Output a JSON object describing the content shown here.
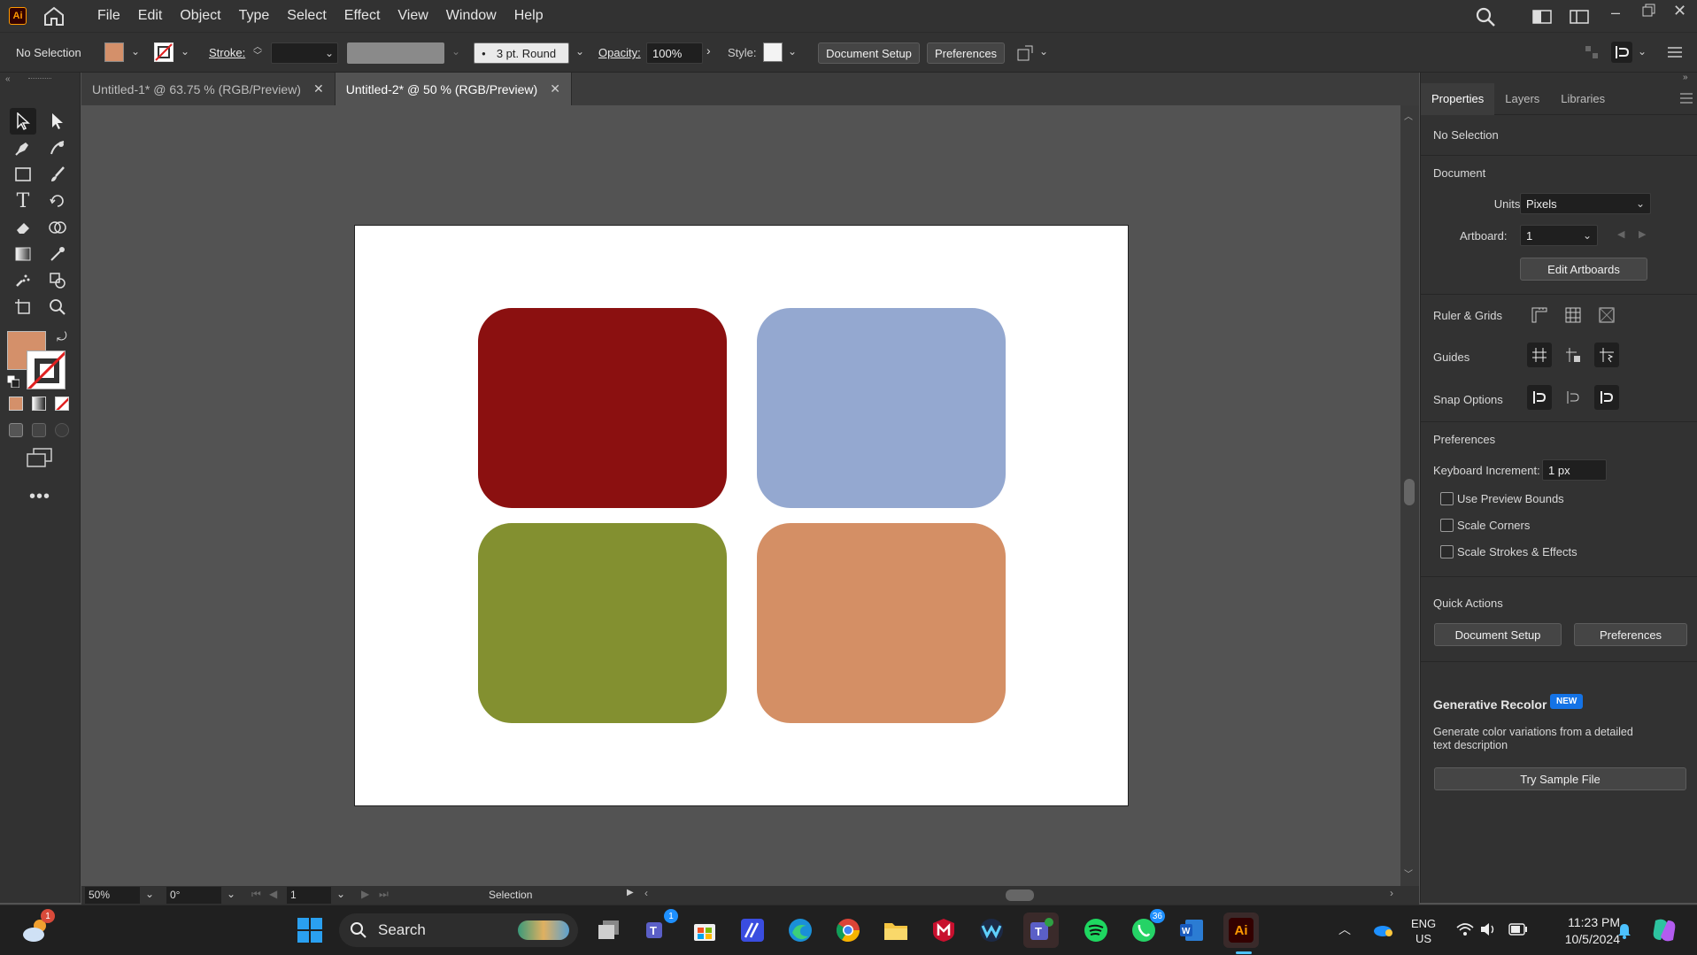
{
  "app": {
    "name": "Ai",
    "brand_color": "#ff9a00",
    "home_icon": "home-icon"
  },
  "menu": [
    "File",
    "Edit",
    "Object",
    "Type",
    "Select",
    "Effect",
    "View",
    "Window",
    "Help"
  ],
  "control_bar": {
    "selection_state": "No Selection",
    "fill_color": "#d4906a",
    "stroke_label": "Stroke:",
    "brush_label": "3 pt. Round",
    "opacity_label": "Opacity:",
    "opacity_value": "100%",
    "style_label": "Style:",
    "document_setup": "Document Setup",
    "preferences": "Preferences"
  },
  "tabs": [
    {
      "label": "Untitled-1* @ 63.75 % (RGB/Preview)",
      "active": false
    },
    {
      "label": "Untitled-2* @ 50 % (RGB/Preview)",
      "active": true
    }
  ],
  "artboard": {
    "background": "#ffffff",
    "shapes": [
      {
        "name": "dark-red-rectangle",
        "color": "#8b1010"
      },
      {
        "name": "blue-rectangle",
        "color": "#94a8d0"
      },
      {
        "name": "olive-rectangle",
        "color": "#839030"
      },
      {
        "name": "orange-rectangle",
        "color": "#d48f65"
      }
    ]
  },
  "properties_panel": {
    "tabs": [
      "Properties",
      "Layers",
      "Libraries"
    ],
    "selection": "No Selection",
    "document_title": "Document",
    "units_label": "Units:",
    "units_value": "Pixels",
    "artboard_label": "Artboard:",
    "artboard_value": "1",
    "edit_artboards": "Edit Artboards",
    "ruler_grids": "Ruler & Grids",
    "guides": "Guides",
    "snap_options": "Snap Options",
    "preferences_title": "Preferences",
    "keyboard_increment_label": "Keyboard Increment:",
    "keyboard_increment_value": "1 px",
    "checkboxes": [
      "Use Preview Bounds",
      "Scale Corners",
      "Scale Strokes & Effects"
    ],
    "quick_actions": "Quick Actions",
    "qa_document_setup": "Document Setup",
    "qa_preferences": "Preferences",
    "gen_recolor_title": "Generative Recolor",
    "gen_recolor_badge": "NEW",
    "gen_recolor_desc": "Generate color variations from a detailed text description",
    "try_sample": "Try Sample File"
  },
  "status_bar": {
    "zoom": "50%",
    "rotation": "0°",
    "artboard_nav": "1",
    "tool": "Selection"
  },
  "taskbar": {
    "search_label": "Search",
    "teams_badge": "1",
    "whatsapp_badge": "36",
    "weather_badge": "1",
    "language": "ENG",
    "region": "US",
    "time": "11:23 PM",
    "date": "10/5/2024"
  }
}
